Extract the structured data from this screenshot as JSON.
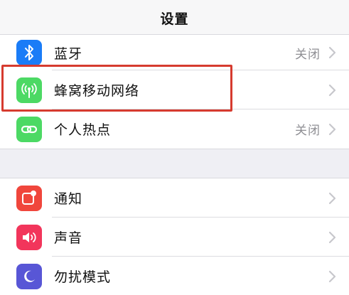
{
  "navbar": {
    "title": "设置"
  },
  "group1": [
    {
      "label": "蓝牙",
      "value": "关闭",
      "icon": "bluetooth-icon",
      "color": "#1a7cf7"
    },
    {
      "label": "蜂窝移动网络",
      "value": "",
      "icon": "antenna-icon",
      "color": "#4cd964"
    },
    {
      "label": "个人热点",
      "value": "关闭",
      "icon": "hotspot-icon",
      "color": "#4cd964"
    }
  ],
  "group2": [
    {
      "label": "通知",
      "icon": "notification-icon",
      "color": "#f0463c"
    },
    {
      "label": "声音",
      "icon": "speaker-icon",
      "color": "#f2355b"
    },
    {
      "label": "勿扰模式",
      "icon": "moon-icon",
      "color": "#5856d6"
    }
  ],
  "highlight_color": "#d63b2f"
}
